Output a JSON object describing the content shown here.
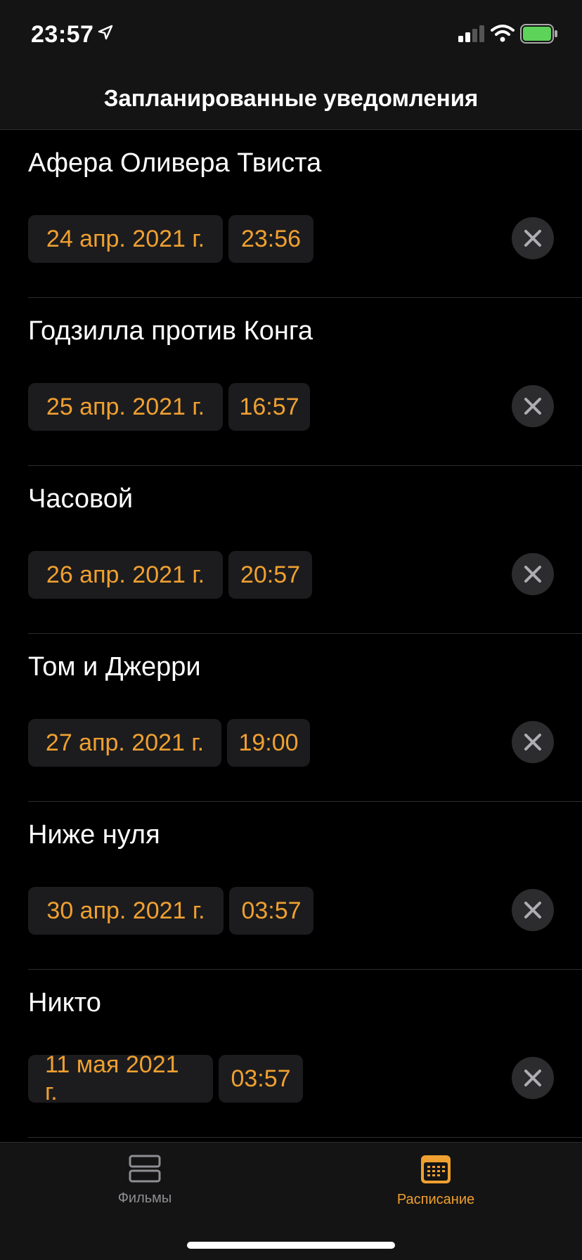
{
  "status_bar": {
    "time": "23:57",
    "icons": [
      "location-arrow-icon",
      "cellular-signal-icon",
      "wifi-icon",
      "battery-icon"
    ]
  },
  "nav": {
    "title": "Запланированные уведомления"
  },
  "accent_color": "#f0a030",
  "notifications": [
    {
      "title": "Афера Оливера Твиста",
      "date": "24 апр. 2021 г.",
      "time": "23:56"
    },
    {
      "title": "Годзилла против Конга",
      "date": "25 апр. 2021 г.",
      "time": "16:57"
    },
    {
      "title": "Часовой",
      "date": "26 апр. 2021 г.",
      "time": "20:57"
    },
    {
      "title": "Том и Джерри",
      "date": "27 апр. 2021 г.",
      "time": "19:00"
    },
    {
      "title": "Ниже нуля",
      "date": "30 апр. 2021 г.",
      "time": "03:57"
    },
    {
      "title": "Никто",
      "date": "11 мая 2021 г.",
      "time": "03:57"
    }
  ],
  "tab_bar": {
    "tabs": [
      {
        "label": "Фильмы",
        "icon": "films-icon",
        "selected": false
      },
      {
        "label": "Расписание",
        "icon": "calendar-icon",
        "selected": true
      }
    ]
  }
}
